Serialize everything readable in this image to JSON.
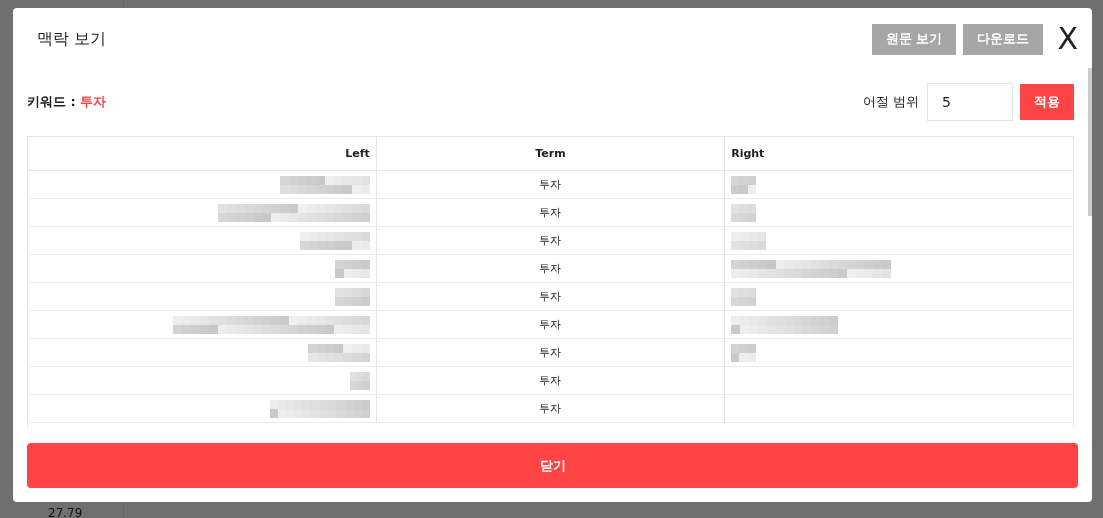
{
  "background": {
    "texts": [
      "27.79"
    ]
  },
  "dialog": {
    "title": "맥락 보기",
    "buttons": [
      {
        "label": "원문 보기"
      },
      {
        "label": "다운로드"
      }
    ],
    "close": "X"
  },
  "keyword": {
    "label": "키워드 :",
    "value": "투자"
  },
  "range": {
    "label": "어절 범위",
    "value": "5",
    "apply": "적용"
  },
  "table": {
    "columns": [
      "Left",
      "Term",
      "Right"
    ],
    "rows": [
      {
        "left": {
          "kind": "redacted"
        },
        "term": "투자",
        "right": {
          "kind": "redacted"
        }
      },
      {
        "left": {
          "kind": "redacted"
        },
        "term": "투자",
        "right": {
          "kind": "redacted"
        }
      },
      {
        "left": {
          "kind": "redacted"
        },
        "term": "투자",
        "right": {
          "kind": "redacted"
        }
      },
      {
        "left": {
          "kind": "redacted"
        },
        "term": "투자",
        "right": {
          "kind": "redacted"
        }
      },
      {
        "left": {
          "kind": "redacted"
        },
        "term": "투자",
        "right": {
          "kind": "redacted"
        }
      },
      {
        "left": {
          "kind": "redacted"
        },
        "term": "투자",
        "right": {
          "kind": "redacted"
        }
      },
      {
        "left": {
          "kind": "redacted"
        },
        "term": "투자",
        "right": {
          "kind": "redacted"
        }
      },
      {
        "left": {
          "kind": "redacted"
        },
        "term": "투자",
        "right": {
          "kind": "empty"
        }
      },
      {
        "left": {
          "kind": "redacted"
        },
        "term": "투자",
        "right": {
          "kind": "empty"
        }
      }
    ]
  },
  "footer": {
    "button": "닫기"
  }
}
